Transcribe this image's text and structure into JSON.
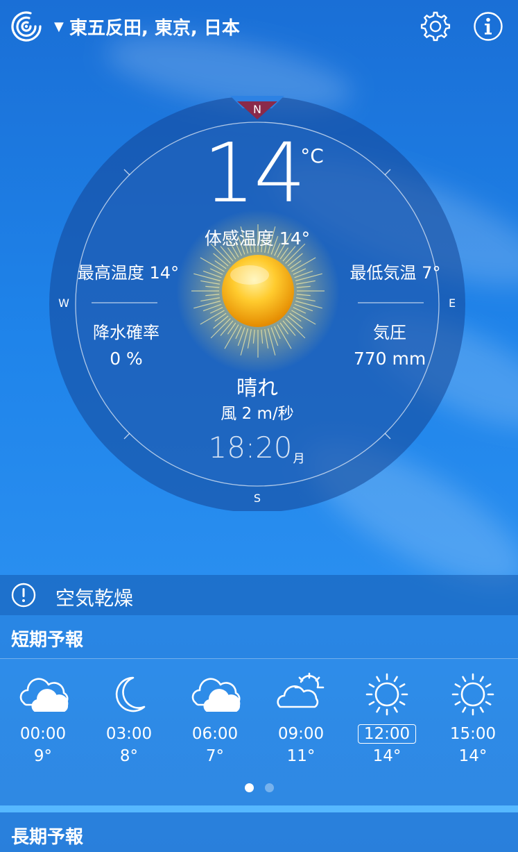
{
  "location": "東五反田, 東京, 日本",
  "topbar": {
    "dropdown_icon": "caret-down-icon",
    "logo_icon": "radar-logo-icon",
    "settings_icon": "gear-icon",
    "info_icon": "info-icon"
  },
  "compass": {
    "north": "N",
    "south": "S",
    "west": "W",
    "east": "E"
  },
  "current": {
    "temperature": "14",
    "unit": "°C",
    "feels_like": "体感温度 14°",
    "high": "最高温度 14°",
    "low": "最低気温 7°",
    "precip_label": "降水確率",
    "precip_value": "0 %",
    "pressure_label": "気圧",
    "pressure_value": "770 mm",
    "condition": "晴れ",
    "wind": "風 2 m/秒",
    "time": "18:20",
    "day": "月"
  },
  "alert": {
    "icon": "exclamation-circle-icon",
    "text": "空気乾燥"
  },
  "short_forecast": {
    "title": "短期予報",
    "items": [
      {
        "time": "00:00",
        "temp": "9°",
        "icon": "cloudy-icon"
      },
      {
        "time": "03:00",
        "temp": "8°",
        "icon": "moon-icon"
      },
      {
        "time": "06:00",
        "temp": "7°",
        "icon": "cloudy-icon"
      },
      {
        "time": "09:00",
        "temp": "11°",
        "icon": "partly-sunny-icon"
      },
      {
        "time": "12:00",
        "temp": "14°",
        "icon": "sun-icon",
        "selected": true
      },
      {
        "time": "15:00",
        "temp": "14°",
        "icon": "sun-icon"
      }
    ],
    "page_current": 1,
    "page_count": 2
  },
  "long_forecast": {
    "title": "長期予報"
  },
  "colors": {
    "accent_north": "#8a2a4a",
    "sky_blue": "#1f84ea",
    "separator": "#56b8ff"
  }
}
